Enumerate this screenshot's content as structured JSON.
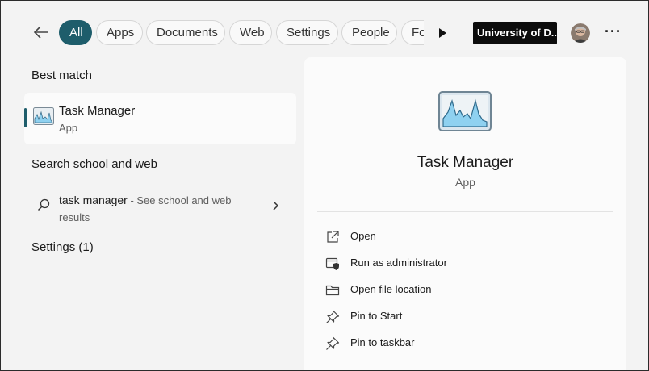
{
  "filters": [
    {
      "label": "All",
      "active": true
    },
    {
      "label": "Apps"
    },
    {
      "label": "Documents"
    },
    {
      "label": "Web"
    },
    {
      "label": "Settings"
    },
    {
      "label": "People"
    },
    {
      "label": "Fo"
    }
  ],
  "org_button": "University of D...",
  "sections": {
    "best_match": "Best match",
    "search_web": "Search school and web",
    "settings": "Settings (1)"
  },
  "best_match_item": {
    "title": "Task Manager",
    "subtitle": "App"
  },
  "web_result": {
    "query": "task manager",
    "suffix": " - See school and web results"
  },
  "detail": {
    "title": "Task Manager",
    "subtitle": "App",
    "actions": [
      {
        "label": "Open",
        "icon": "open-external-icon"
      },
      {
        "label": "Run as administrator",
        "icon": "shield-icon"
      },
      {
        "label": "Open file location",
        "icon": "folder-icon"
      },
      {
        "label": "Pin to Start",
        "icon": "pin-icon"
      },
      {
        "label": "Pin to taskbar",
        "icon": "pin-icon"
      }
    ]
  },
  "colors": {
    "accent": "#1e5d6b",
    "panel": "#fbfbfb",
    "background": "#f3f3f3"
  }
}
